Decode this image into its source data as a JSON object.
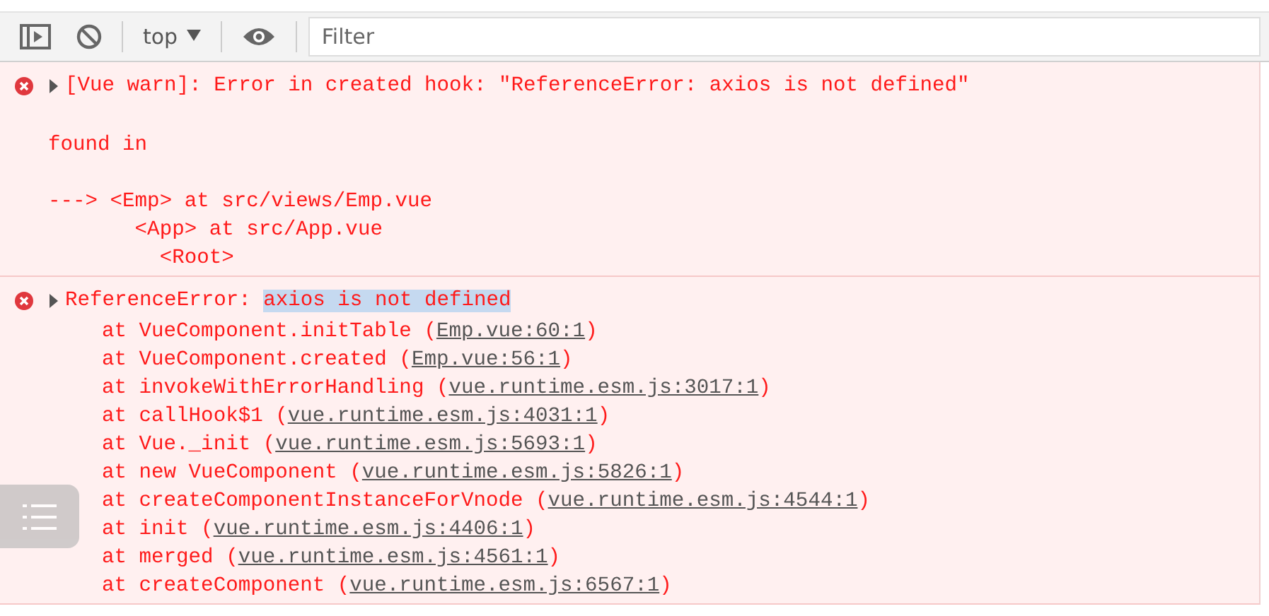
{
  "toolbar": {
    "context": "top",
    "filter_placeholder": "Filter"
  },
  "messages": [
    {
      "kind": "error",
      "expanded": false,
      "header": "[Vue warn]: Error in created hook: \"ReferenceError: axios is not defined\"",
      "lines": [
        "found in",
        "---> <Emp> at src/views/Emp.vue",
        "       <App> at src/App.vue",
        "         <Root>"
      ]
    },
    {
      "kind": "error",
      "expanded": false,
      "header": "ReferenceError: ",
      "selection": "axios is not defined",
      "stack": [
        {
          "prefix": "at VueComponent.initTable (",
          "link": "Emp.vue:60:1",
          "suffix": ")"
        },
        {
          "prefix": "at VueComponent.created (",
          "link": "Emp.vue:56:1",
          "suffix": ")"
        },
        {
          "prefix": "at invokeWithErrorHandling (",
          "link": "vue.runtime.esm.js:3017:1",
          "suffix": ")"
        },
        {
          "prefix": "at callHook$1 (",
          "link": "vue.runtime.esm.js:4031:1",
          "suffix": ")"
        },
        {
          "prefix": "at Vue._init (",
          "link": "vue.runtime.esm.js:5693:1",
          "suffix": ")"
        },
        {
          "prefix": "at new VueComponent (",
          "link": "vue.runtime.esm.js:5826:1",
          "suffix": ")"
        },
        {
          "prefix": "at createComponentInstanceForVnode (",
          "link": "vue.runtime.esm.js:4544:1",
          "suffix": ")"
        },
        {
          "prefix": "at init (",
          "link": "vue.runtime.esm.js:4406:1",
          "suffix": ")"
        },
        {
          "prefix": "at merged (",
          "link": "vue.runtime.esm.js:4561:1",
          "suffix": ")"
        },
        {
          "prefix": "at createComponent (",
          "link": "vue.runtime.esm.js:6567:1",
          "suffix": ")"
        }
      ]
    }
  ]
}
